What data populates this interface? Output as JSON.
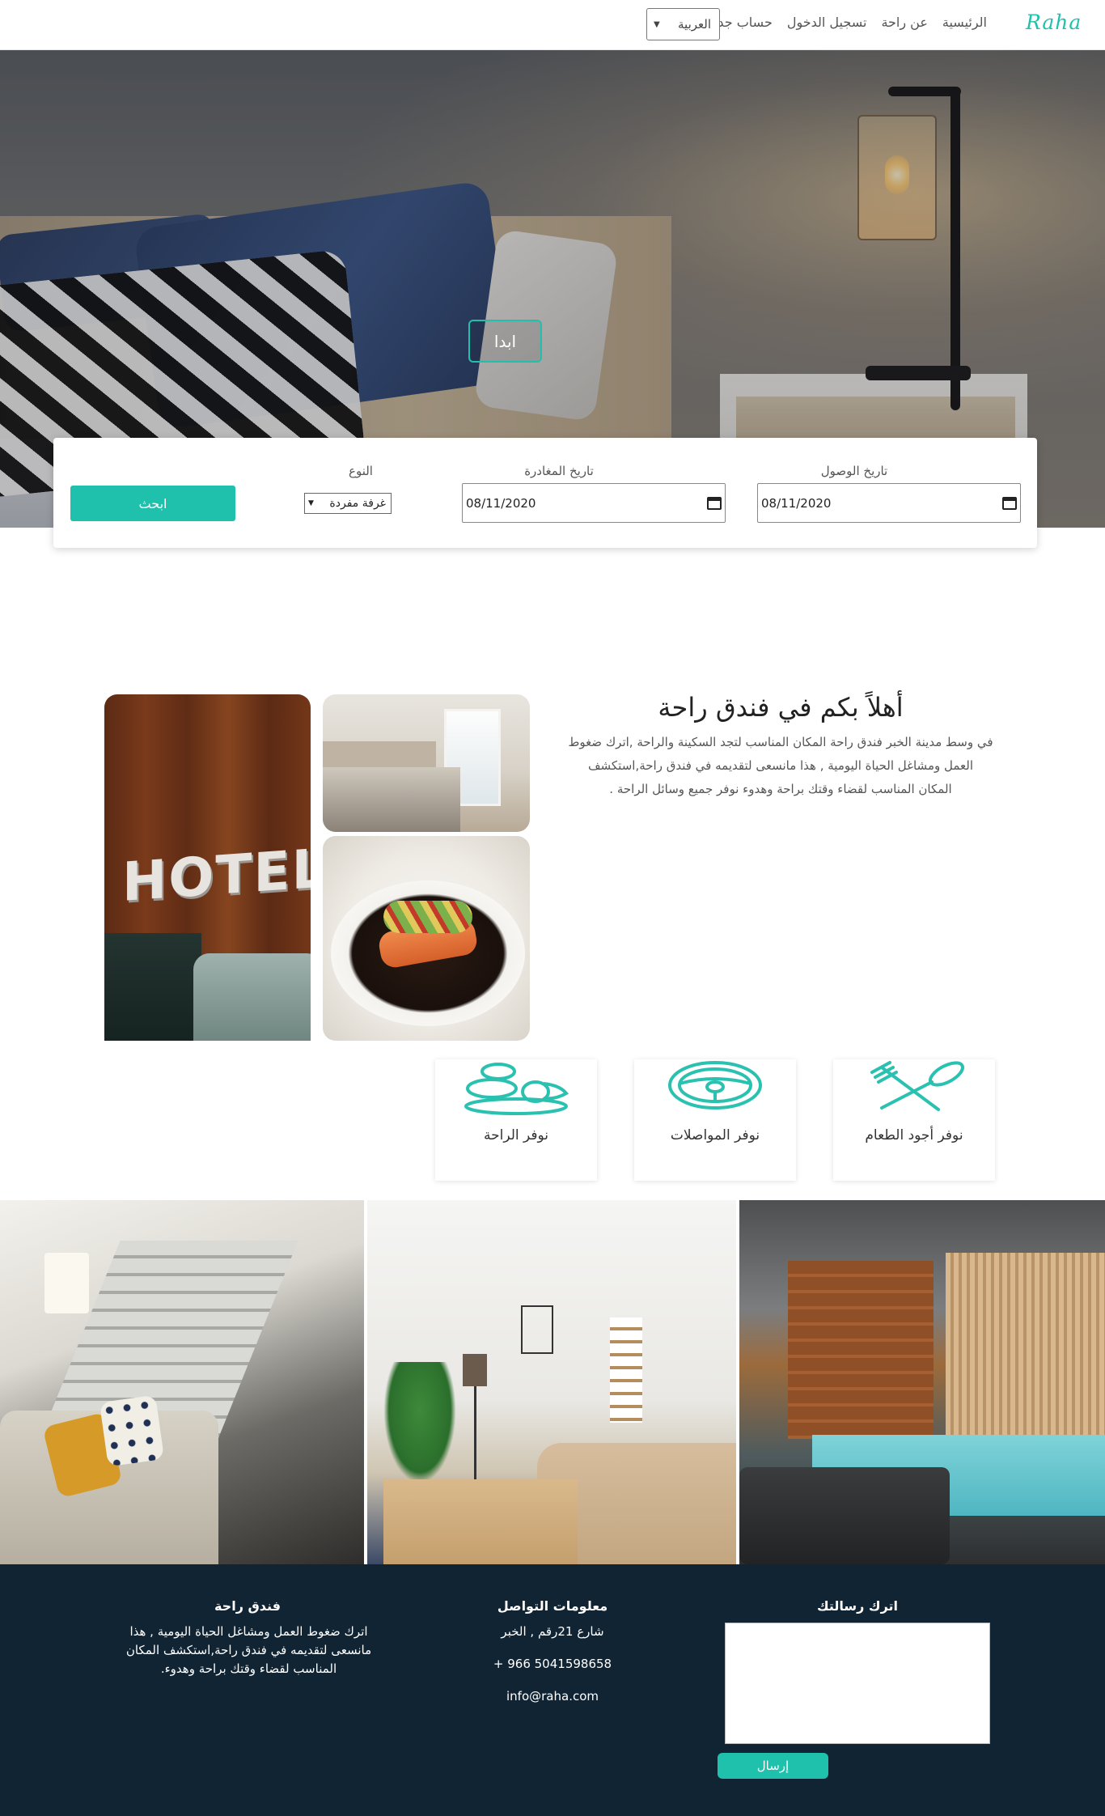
{
  "nav": {
    "logo": "Raha",
    "links": [
      "الرئيسية",
      "عن راحة",
      "تسجيل الدخول",
      "حساب جديد"
    ],
    "language": "العربية"
  },
  "hero": {
    "start_label": "ابدا"
  },
  "search": {
    "arrival_label": "تاريخ الوصول",
    "arrival_value": "08/11/2020",
    "departure_label": "تاريخ المغادرة",
    "departure_value": "08/11/2020",
    "type_label": "النوع",
    "type_value": "غرفة مفردة",
    "search_label": "ابحث"
  },
  "welcome": {
    "title": "أهلاً بكم في فندق راحة",
    "line1": "في وسط مدينة الخبر فندق راحة المكان المناسب لتجد السكينة والراحة ,اترك ضغوط",
    "line2": "العمل ومشاغل الحياة اليومية , هذا مانسعى لتقديمه في فندق راحة,استكشف",
    "line3": "المكان المناسب لقضاء وقتك براحة وهدوء نوفر جميع وسائل الراحة ."
  },
  "features": [
    {
      "label": "نوفر أجود الطعام",
      "icon": "fork-spoon-icon"
    },
    {
      "label": "نوفر المواصلات",
      "icon": "steering-wheel-icon"
    },
    {
      "label": "نوفر الراحة",
      "icon": "spa-stones-icon"
    }
  ],
  "footer": {
    "message_title": "اترك رسالتك",
    "send_label": "إرسال",
    "contact_title": "معلومات التواصل",
    "address": "شارع 21رقم , الخبر",
    "phone": "+ 966 5041598658",
    "email": "info@raha.com",
    "about_title": "فندق راحة",
    "about_line1": "اترك ضغوط العمل ومشاغل الحياة اليومية , هذا",
    "about_line2": "مانسعى لتقديمه في فندق راحة,استكشف المكان",
    "about_line3": "المناسب لقضاء وقتك براحة وهدوء."
  },
  "colors": {
    "accent": "#1fc1ad",
    "footer_bg": "#102434"
  }
}
